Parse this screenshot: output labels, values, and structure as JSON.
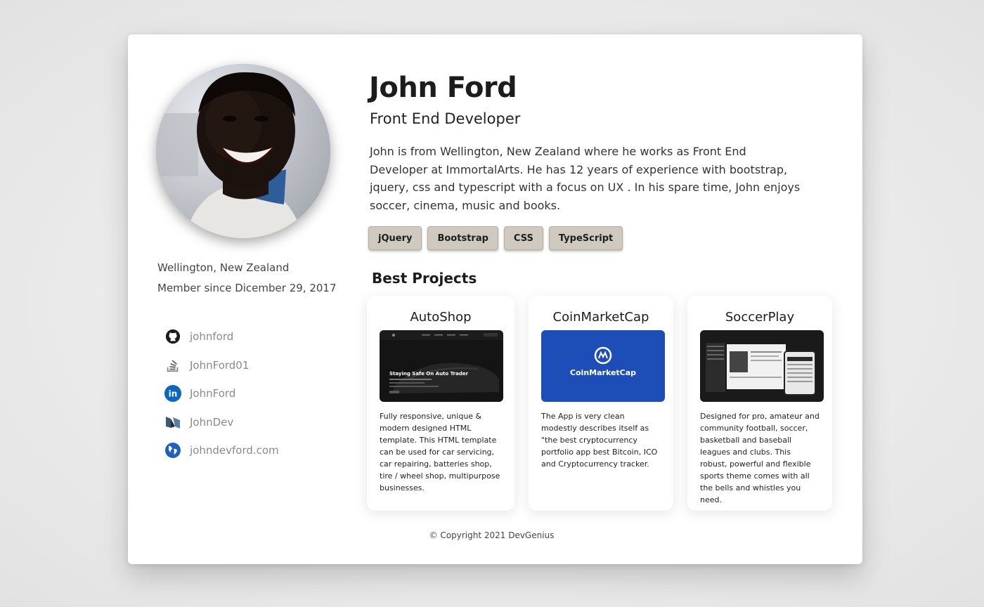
{
  "profile": {
    "name": "John Ford",
    "role": "Front End Developer",
    "bio": "John is from Wellington, New Zealand where he works as Front End Developer at ImmortalArts. He has 12 years of experience with bootstrap, jquery, css and typescript with a focus on UX . In his spare time, John enjoys soccer,  cinema, music and books.",
    "location": "Wellington, New Zealand",
    "member_since": "Member since Dicember 29, 2017"
  },
  "skills": [
    "jQuery",
    "Bootstrap",
    "CSS",
    "TypeScript"
  ],
  "social": [
    {
      "icon": "github-icon",
      "label": "johnford"
    },
    {
      "icon": "stackoverflow-icon",
      "label": "JohnFord01"
    },
    {
      "icon": "linkedin-icon",
      "label": "JohnFord"
    },
    {
      "icon": "medium-icon",
      "label": "JohnDev"
    },
    {
      "icon": "globe-icon",
      "label": "johndevford.com"
    }
  ],
  "projects_title": "Best Projects",
  "projects": [
    {
      "name": "AutoShop",
      "thumb_caption": "Staying Safe On Auto Trader",
      "description": "Fully responsive, unique & modern designed HTML template. This HTML template can be used for car servicing, car repairing, batteries shop, tire / wheel shop, multipurpose businesses."
    },
    {
      "name": "CoinMarketCap",
      "thumb_caption": "CoinMarketCap",
      "description": "The App is very clean modestly describes itself as \"the best cryptocurrency portfolio app best Bitcoin, ICO and Cryptocurrency tracker."
    },
    {
      "name": "SoccerPlay",
      "thumb_caption": "",
      "description": "Designed for pro, amateur and community football, soccer, basketball and baseball leagues and clubs. This robust, powerful and flexible sports theme comes with all the bells and whistles you need."
    }
  ],
  "footer": "© Copyright 2021 DevGenius",
  "colors": {
    "tag_bg": "#cfc9c0",
    "linkedin": "#0a66c2",
    "globe": "#1f5fbf",
    "coinmarketcap_bg": "#1d4eb8"
  }
}
